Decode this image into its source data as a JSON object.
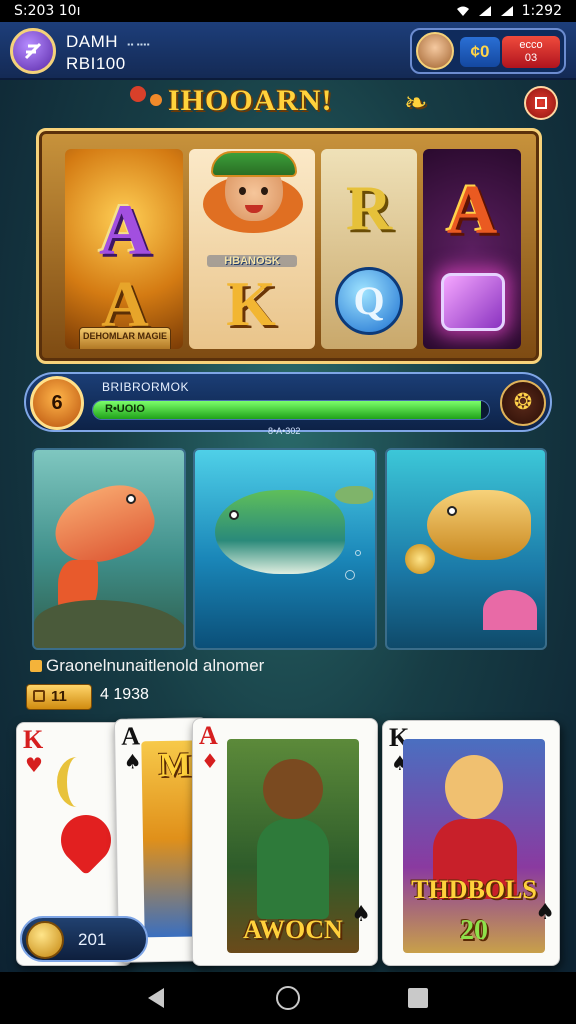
{
  "status_bar": {
    "time": "S:203 10ı",
    "battery": "1:292"
  },
  "header": {
    "player_line1": "DAMH",
    "player_line2": "RBI100",
    "tag": "▪▪ ▪▪▪▪",
    "coin_label": "¢0",
    "amount_line1": "ecco",
    "amount_line2": "03"
  },
  "title": {
    "text": "IHOOARN!",
    "left_deco": "❨",
    "right_deco": "❧"
  },
  "slot": {
    "reel1": {
      "top": "A",
      "bottom": "A",
      "plaque": "DEHOMLAR MAGIE"
    },
    "reel2": {
      "label": "HBANOSK",
      "letter": "K"
    },
    "reel3": {
      "top": "R",
      "bottom": "Q"
    },
    "reel4": {
      "top": "A"
    },
    "caption": "▪▪▪▪▪▪▪▪▪▪▪▪"
  },
  "progress": {
    "level": "6",
    "title": "BRIBRORMOK",
    "bar_label": "R•UOIO",
    "fill": 0.98,
    "sub": "8•A•302",
    "icon": "❂"
  },
  "info": {
    "line": "Graonelnunaitlenold alnomer",
    "chip_count": "11",
    "total": "4 1938"
  },
  "cards": {
    "c1": {
      "rank": "K",
      "suit": "♥"
    },
    "c2": {
      "rank": "A",
      "suit": "♠",
      "title": "M"
    },
    "c3": {
      "rank": "A",
      "suit": "♦",
      "title": "AWOCN",
      "corner": "♠"
    },
    "c4": {
      "rank": "K",
      "suit": "♠",
      "title": "THDBOLS",
      "number": "20",
      "corner": "♠"
    }
  },
  "coin_chip": {
    "value": "201"
  },
  "colors": {
    "header": "#1d3e7a",
    "gold": "#ffd23c",
    "progress": "#1fa21a",
    "danger": "#e33a2e"
  }
}
